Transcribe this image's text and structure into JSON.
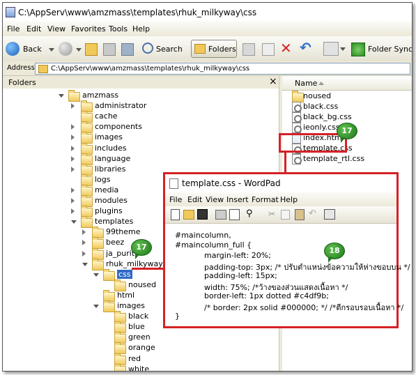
{
  "window": {
    "title": "C:\\AppServ\\www\\amzmass\\templates\\rhuk_milkyway\\css"
  },
  "menu": [
    "File",
    "Edit",
    "View",
    "Favorites",
    "Tools",
    "Help"
  ],
  "toolbar": {
    "back": "Back",
    "search": "Search",
    "folders": "Folders",
    "folder_sync": "Folder Sync"
  },
  "address": {
    "label": "Address",
    "value": "C:\\AppServ\\www\\amzmass\\templates\\rhuk_milkyway\\css"
  },
  "folders_pane": {
    "title": "Folders",
    "close": "×",
    "tree": [
      "amzmass",
      "administrator",
      "cache",
      "components",
      "images",
      "includes",
      "language",
      "libraries",
      "logs",
      "media",
      "modules",
      "plugins",
      "templates",
      "99theme",
      "beez",
      "ja_purity",
      "rhuk_milkyway",
      "css",
      "noused",
      "html",
      "images",
      "black",
      "blue",
      "green",
      "orange",
      "red",
      "white"
    ]
  },
  "files_pane": {
    "column": "Name",
    "files": [
      "noused",
      "black.css",
      "black_bg.css",
      "ieonly.css",
      "index.html",
      "template.css",
      "template_rtl.css"
    ]
  },
  "wordpad": {
    "title": "template.css - WordPad",
    "menu": [
      "File",
      "Edit",
      "View",
      "Insert",
      "Format",
      "Help"
    ],
    "lines": [
      "#maincolumn,",
      "#maincolumn_full {",
      "margin-left: 20%;",
      "padding-top: 3px; /* ปรับตำแหน่งข้อความให้ห่างขอบบน */",
      "padding-left: 15px;",
      "width: 75%; /*ว้างของส่วนแสดงเนื้อหา */",
      "border-left: 1px dotted #c4df9b;",
      "/* border: 2px solid #000000; */ /*ตีกรอบรอบเนื้อหา */",
      "}"
    ]
  },
  "badges": {
    "folder": "17",
    "file": "17",
    "code": "18"
  },
  "colors": {
    "highlight": "#d52026",
    "selection": "#316ac5",
    "badge": "#2a8a22"
  }
}
